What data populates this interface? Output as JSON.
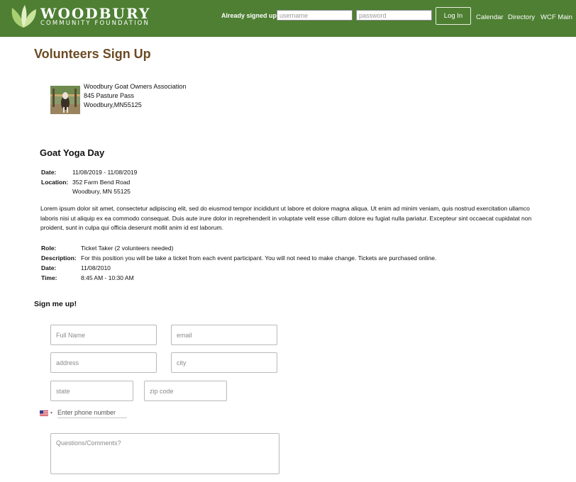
{
  "header": {
    "logo_name": "WOODBURY",
    "logo_subtitle": "COMMUNITY FOUNDATION",
    "signin_label": "Already signed up?",
    "username_placeholder": "username",
    "password_placeholder": "password",
    "login_label": "Log In",
    "nav": [
      "Calendar",
      "Directory",
      "WCF Main"
    ]
  },
  "page_title": "Volunteers Sign Up",
  "organization": {
    "name": "Woodbury Goat Owners Association",
    "street": "845 Pasture Pass",
    "city_state_zip": "Woodbury,MN55125"
  },
  "event": {
    "title": "Goat Yoga Day",
    "date_label": "Date:",
    "date_value": "11/08/2019 - 11/08/2019",
    "location_label": "Location:",
    "location_line1": "352 Farm Bend Road",
    "location_line2": "Woodbury, MN 55125",
    "description": "Lorem ipsum dolor sit amet, consectetur adipiscing elit, sed do eiusmod tempor incididunt ut labore et dolore magna aliqua. Ut enim ad minim veniam, quis nostrud exercitation ullamco laboris nisi ut aliquip ex ea commodo consequat. Duis aute irure dolor in reprehenderit in voluptate velit esse cillum dolore eu fugiat nulla pariatur. Excepteur sint occaecat cupidatat non proident, sunt in culpa qui officia deserunt mollit anim id est laborum."
  },
  "role": {
    "role_label": "Role:",
    "role_value": "Ticket Taker (2 volunteers needed)",
    "description_label": "Description:",
    "description_value": "For this position you will be take a ticket from each event participant. You will not need to make change. Tickets are purchased online.",
    "date_label": "Date:",
    "date_value": "11/08/2010",
    "time_label": "Time:",
    "time_value": "8:45 AM - 10:30 AM"
  },
  "signup": {
    "heading": "Sign me up!",
    "full_name_placeholder": "Full Name",
    "email_placeholder": "email",
    "address_placeholder": "address",
    "city_placeholder": "city",
    "state_placeholder": "state",
    "zip_placeholder": "zip code",
    "phone_placeholder": "Enter phone number",
    "comments_placeholder": "Questions/Comments?",
    "phone_country_icon": "us-flag-icon"
  },
  "colors": {
    "header_green": "#4e7f33",
    "title_brown": "#6b4a22"
  }
}
